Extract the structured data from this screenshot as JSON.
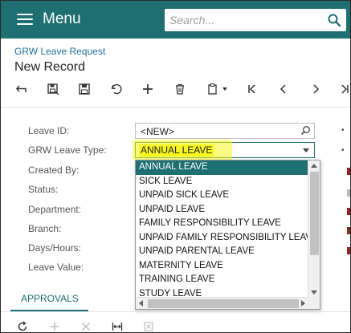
{
  "header": {
    "menu_label": "Menu",
    "search_placeholder": "Search..."
  },
  "breadcrumb": "GRW Leave Request",
  "page_title": "New Record",
  "toolbar": {
    "icons": [
      "undo-arrow-icon",
      "save-close-icon",
      "save-icon",
      "cancel-icon",
      "add-icon",
      "delete-icon",
      "copy-paste-icon",
      "first-record-icon",
      "previous-record-icon",
      "next-record-icon",
      "last-record-icon"
    ]
  },
  "form": {
    "leave_id_label": "Leave ID:",
    "leave_id_value": "<NEW>",
    "leave_type_label": "GRW Leave Type:",
    "leave_type_value": "ANNUAL LEAVE",
    "created_by_label": "Created By:",
    "status_label": "Status:",
    "department_label": "Department:",
    "branch_label": "Branch:",
    "days_hours_label": "Days/Hours:",
    "leave_value_label": "Leave Value:"
  },
  "dropdown": {
    "selected_index": 0,
    "options": [
      "ANNUAL LEAVE",
      "SICK LEAVE",
      "UNPAID SICK LEAVE",
      "UNPAID LEAVE",
      "FAMILY RESPONSIBILITY LEAVE",
      "UNPAID FAMILY RESPONSIBILITY LEAVE",
      "UNPAID PARENTAL LEAVE",
      "MATERNITY LEAVE",
      "TRAINING LEAVE",
      "STUDY LEAVE"
    ]
  },
  "tabs": {
    "approvals": "APPROVALS"
  },
  "colors": {
    "accent": "#1e6f72",
    "highlight": "#f6f61a",
    "link": "#1e6f9e"
  }
}
